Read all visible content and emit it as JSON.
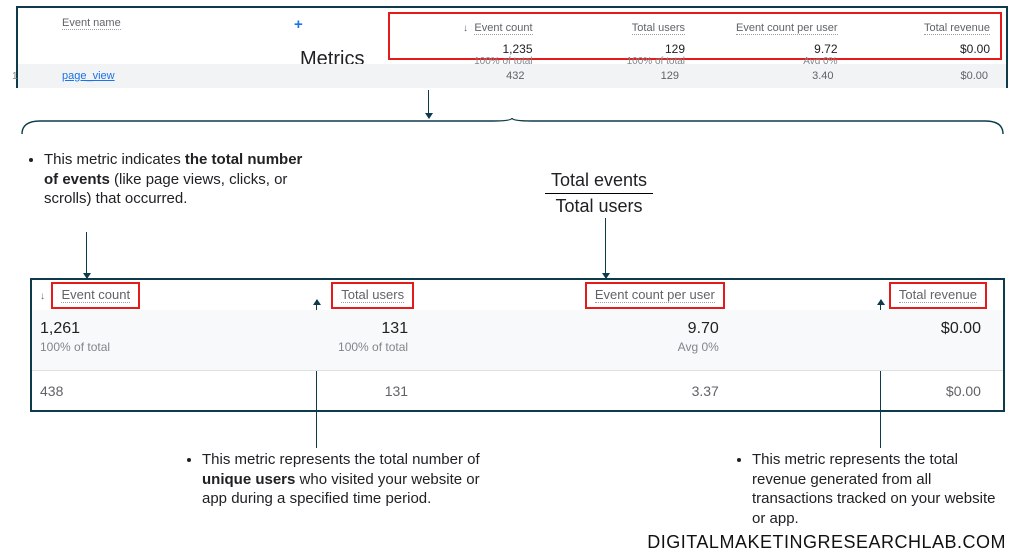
{
  "labels": {
    "event_name": "Event name",
    "metrics": "Metrics",
    "event_count": "Event count",
    "total_users": "Total users",
    "ecpu": "Event count per user",
    "total_rev": "Total revenue",
    "plus": "+",
    "row_idx": "1"
  },
  "top": {
    "event_count": "1,235",
    "event_count_sub": "100% of total",
    "total_users": "129",
    "total_users_sub": "100% of total",
    "ecpu": "9.72",
    "ecpu_sub": "Avg 0%",
    "total_rev": "$0.00",
    "row": {
      "event_name": "page_view",
      "event_count": "432",
      "total_users": "129",
      "ecpu": "3.40",
      "total_rev": "$0.00"
    }
  },
  "fraction": {
    "top": "Total events",
    "bottom": "Total users"
  },
  "notes": {
    "ec_a": "This metric indicates ",
    "ec_b": "the total number of events",
    "ec_c": " (like page views, clicks, or scrolls) that occurred.",
    "tu_a": "This metric represents the total number of ",
    "tu_b": "unique users",
    "tu_c": " who visited your website or app during a specified time period.",
    "tr": "This metric represents the total revenue generated from all transactions tracked on your website or app."
  },
  "second": {
    "event_count": "1,261",
    "event_count_sub": "100% of total",
    "total_users": "131",
    "total_users_sub": "100% of total",
    "ecpu": "9.70",
    "ecpu_sub": "Avg 0%",
    "total_rev": "$0.00",
    "row": {
      "event_count": "438",
      "total_users": "131",
      "ecpu": "3.37",
      "total_rev": "$0.00"
    }
  },
  "watermark": "DIGITALMAKETINGRESEARCHLAB.COM"
}
